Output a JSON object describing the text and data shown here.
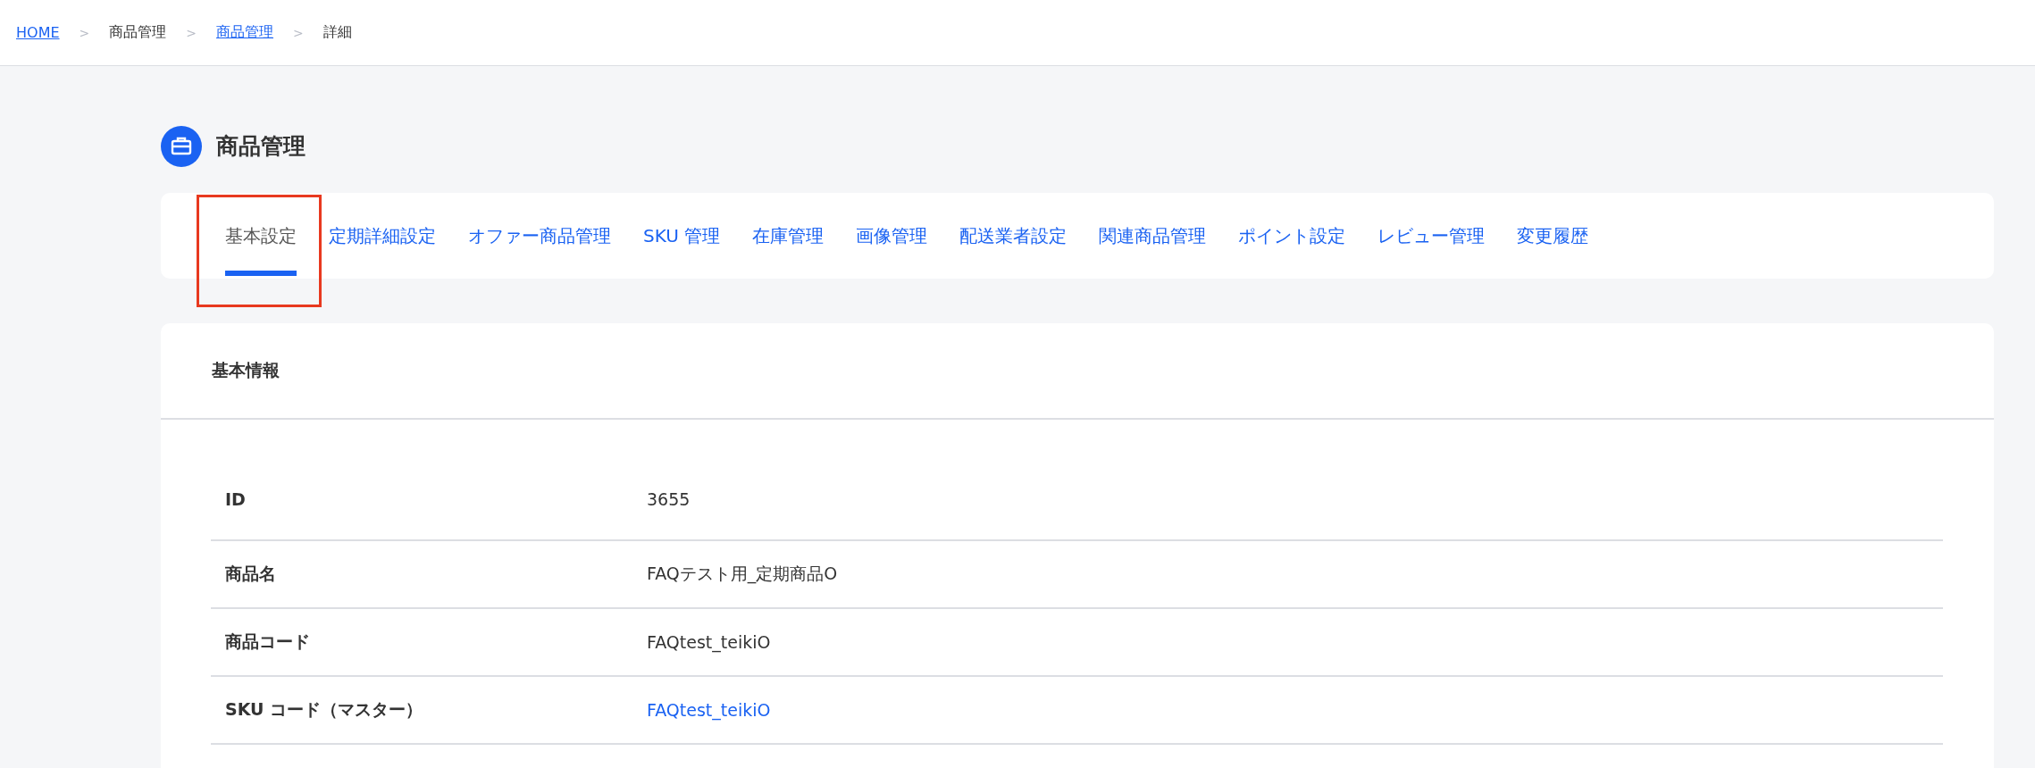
{
  "breadcrumb": [
    {
      "label": "HOME",
      "link": true
    },
    {
      "label": "商品管理",
      "link": false
    },
    {
      "label": "商品管理",
      "link": true
    },
    {
      "label": "詳細",
      "link": false
    }
  ],
  "breadcrumb_separators": [
    ">",
    ">",
    ">"
  ],
  "page_title": "商品管理",
  "tabs": [
    {
      "label": "基本設定",
      "selected": true,
      "highlighted": true
    },
    {
      "label": "定期詳細設定",
      "selected": false,
      "highlighted": false
    },
    {
      "label": "オファー商品管理",
      "selected": false,
      "highlighted": false
    },
    {
      "label": "SKU 管理",
      "selected": false,
      "highlighted": false
    },
    {
      "label": "在庫管理",
      "selected": false,
      "highlighted": false
    },
    {
      "label": "画像管理",
      "selected": false,
      "highlighted": false
    },
    {
      "label": "配送業者設定",
      "selected": false,
      "highlighted": false
    },
    {
      "label": "関連商品管理",
      "selected": false,
      "highlighted": false
    },
    {
      "label": "ポイント設定",
      "selected": false,
      "highlighted": false
    },
    {
      "label": "レビュー管理",
      "selected": false,
      "highlighted": false
    },
    {
      "label": "変更履歴",
      "selected": false,
      "highlighted": false
    }
  ],
  "section": {
    "title": "基本情報",
    "rows": [
      {
        "label": "ID",
        "value": "3655",
        "link": false
      },
      {
        "label": "商品名",
        "value": "FAQテスト用_定期商品O",
        "link": false
      },
      {
        "label": "商品コード",
        "value": "FAQtest_teikiO",
        "link": false
      },
      {
        "label": "SKU コード（マスター）",
        "value": "FAQtest_teikiO",
        "link": true
      }
    ]
  }
}
